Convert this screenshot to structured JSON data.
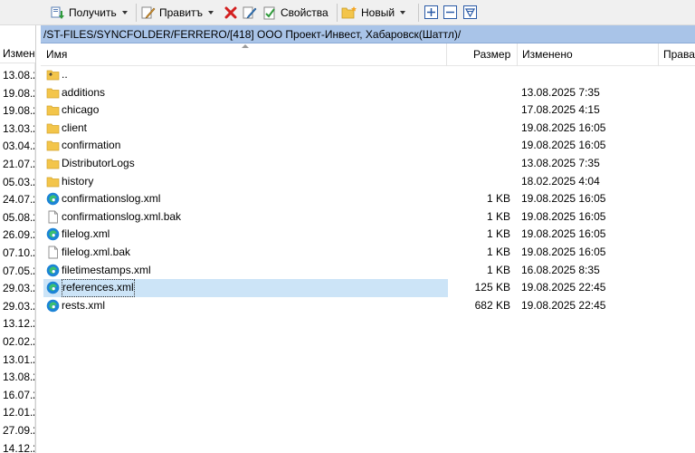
{
  "toolbar": {
    "download_label": "Получить",
    "edit_label": "Правитъ",
    "properties_label": "Свойства",
    "new_label": "Новый"
  },
  "left_pane": {
    "header": "Измен",
    "rows": [
      "13.08.2",
      "19.08.2",
      "19.08.2",
      "13.03.2",
      "03.04.2",
      "21.07.2",
      "05.03.2",
      "24.07.2",
      "05.08.2",
      "26.09.2",
      "07.10.2",
      "07.05.2",
      "29.03.2",
      "29.03.2",
      "13.12.2",
      "02.02.2",
      "13.01.2",
      "13.08.2",
      "16.07.2",
      "12.01.2",
      "27.09.2",
      "14.12.2"
    ]
  },
  "path": "/ST-FILES/SYNCFOLDER/FERRERO/[418] ООО Проект-Инвест, Хабаровск(Шаттл)/",
  "columns": {
    "name": "Имя",
    "size": "Размер",
    "modified": "Изменено",
    "rights": "Права"
  },
  "files": [
    {
      "icon": "parent-dir-icon",
      "name": "..",
      "size": "",
      "date": ""
    },
    {
      "icon": "folder-icon",
      "name": "additions",
      "size": "",
      "date": "13.08.2025 7:35"
    },
    {
      "icon": "folder-icon",
      "name": "chicago",
      "size": "",
      "date": "17.08.2025 4:15"
    },
    {
      "icon": "folder-icon",
      "name": "client",
      "size": "",
      "date": "19.08.2025 16:05"
    },
    {
      "icon": "folder-icon",
      "name": "confirmation",
      "size": "",
      "date": "19.08.2025 16:05"
    },
    {
      "icon": "folder-icon",
      "name": "DistributorLogs",
      "size": "",
      "date": "13.08.2025 7:35"
    },
    {
      "icon": "folder-icon",
      "name": "history",
      "size": "",
      "date": "18.02.2025 4:04"
    },
    {
      "icon": "edge-xml-icon",
      "name": "confirmationslog.xml",
      "size": "1 KB",
      "date": "19.08.2025 16:05"
    },
    {
      "icon": "file-icon",
      "name": "confirmationslog.xml.bak",
      "size": "1 KB",
      "date": "19.08.2025 16:05"
    },
    {
      "icon": "edge-xml-icon",
      "name": "filelog.xml",
      "size": "1 KB",
      "date": "19.08.2025 16:05"
    },
    {
      "icon": "file-icon",
      "name": "filelog.xml.bak",
      "size": "1 KB",
      "date": "19.08.2025 16:05"
    },
    {
      "icon": "edge-xml-icon",
      "name": "filetimestamps.xml",
      "size": "1 KB",
      "date": "16.08.2025 8:35"
    },
    {
      "icon": "edge-xml-icon",
      "name": "references.xml",
      "size": "125 KB",
      "date": "19.08.2025 22:45",
      "selected": true
    },
    {
      "icon": "edge-xml-icon",
      "name": "rests.xml",
      "size": "682 KB",
      "date": "19.08.2025 22:45"
    }
  ],
  "colors": {
    "path_bar": "#a9c4e8",
    "selection": "#cce4f7",
    "folder": "#f3c54a"
  }
}
